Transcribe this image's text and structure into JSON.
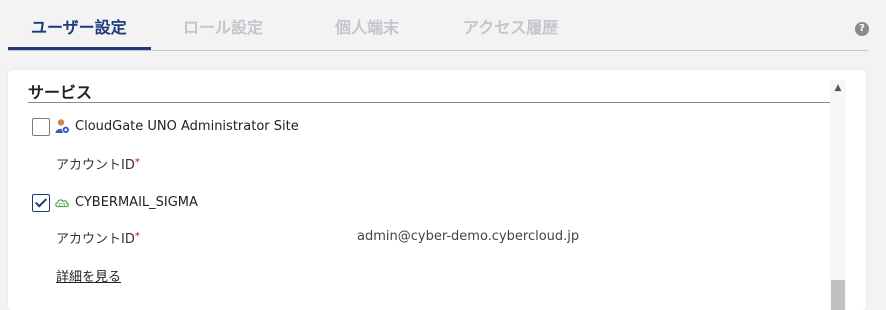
{
  "tabs": [
    {
      "label": "ユーザー設定",
      "active": true
    },
    {
      "label": "ロール設定",
      "active": false
    },
    {
      "label": "個人端末",
      "active": false
    },
    {
      "label": "アクセス履歴",
      "active": false
    }
  ],
  "help_icon": {
    "glyph": "?",
    "icon": "question-circle-icon"
  },
  "section": {
    "title": "サービス"
  },
  "services": [
    {
      "name": "CloudGate UNO Administrator Site",
      "checked": false,
      "icon": "admin-user-icon",
      "account_label": "アカウントID",
      "account_value": ""
    },
    {
      "name": "CYBERMAIL_SIGMA",
      "checked": true,
      "icon": "cloud-mail-icon",
      "account_label": "アカウントID",
      "account_value": "admin@cyber-demo.cybercloud.jp"
    }
  ],
  "required_mark": "*",
  "details_link": "詳細を見る",
  "scrollbar": {
    "up_glyph": "▲"
  },
  "colors": {
    "accent": "#1e3a78",
    "tab_inactive": "#c3c6cc",
    "required": "#d0021b"
  }
}
